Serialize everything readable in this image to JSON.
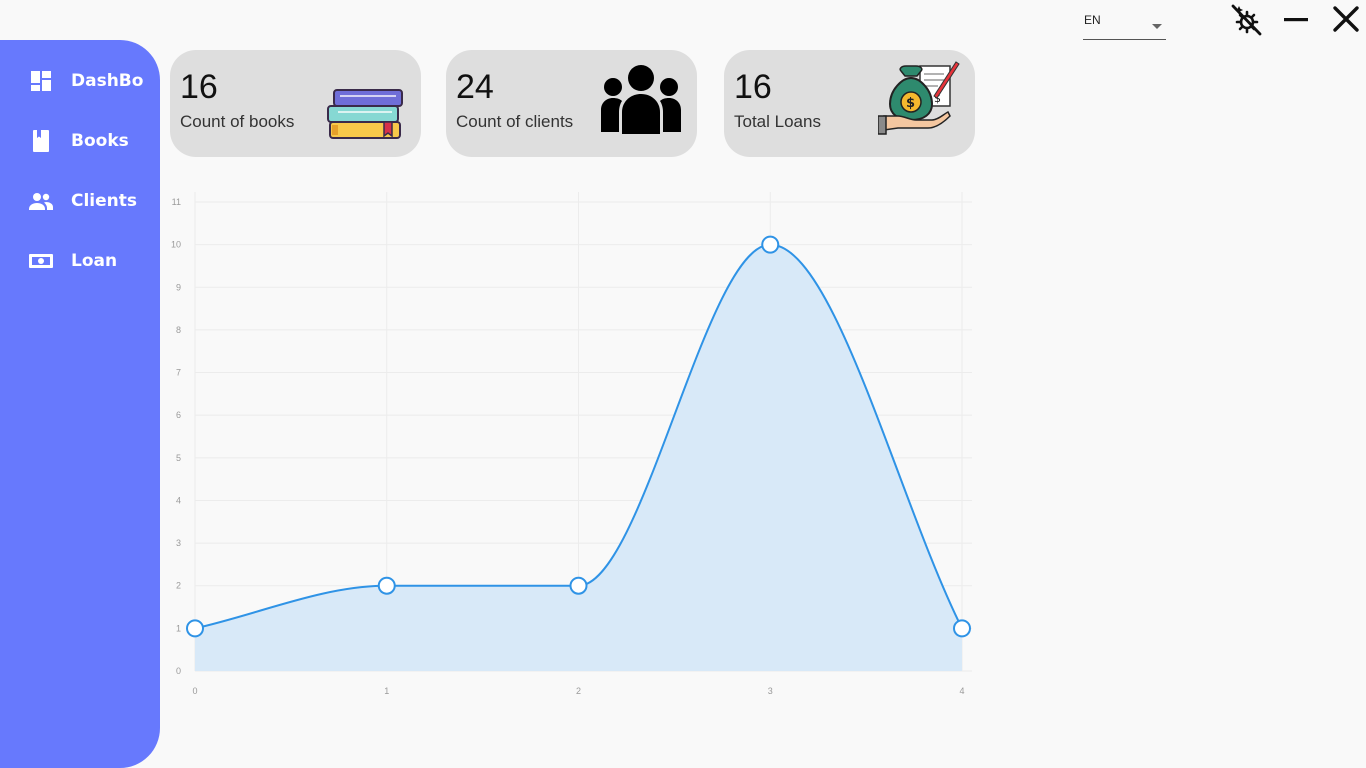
{
  "sidebar": {
    "items": [
      {
        "label": "DashBo",
        "icon": "dashboard-icon"
      },
      {
        "label": "Books",
        "icon": "book-icon"
      },
      {
        "label": "Clients",
        "icon": "people-icon"
      },
      {
        "label": "Loan",
        "icon": "money-icon"
      }
    ]
  },
  "topbar": {
    "language": "EN",
    "icons": [
      "dropdown-caret-icon",
      "theme-toggle-icon",
      "minimize-icon",
      "close-icon"
    ]
  },
  "cards": [
    {
      "value": "16",
      "label": "Count of books",
      "icon": "books-stack-icon"
    },
    {
      "value": "24",
      "label": "Count of clients",
      "icon": "clients-group-icon"
    },
    {
      "value": "16",
      "label": "Total Loans",
      "icon": "money-bag-hand-icon"
    }
  ],
  "colors": {
    "sidebar": "#6779fd",
    "card": "#dedede",
    "line": "#2f93e6",
    "area": "#d8e9f8"
  },
  "chart_data": {
    "type": "area",
    "x": [
      0,
      1,
      2,
      3,
      4
    ],
    "values": [
      1,
      2,
      2,
      10,
      1
    ],
    "x_ticks": [
      "0",
      "1",
      "2",
      "3",
      "4"
    ],
    "y_ticks": [
      "0",
      "1",
      "2",
      "3",
      "4",
      "5",
      "6",
      "7",
      "8",
      "9",
      "10",
      "11"
    ],
    "xlim": [
      0,
      4
    ],
    "ylim": [
      0,
      11
    ],
    "smooth": true,
    "grid": true,
    "markers": "hollow-circle",
    "title": "",
    "xlabel": "",
    "ylabel": ""
  }
}
